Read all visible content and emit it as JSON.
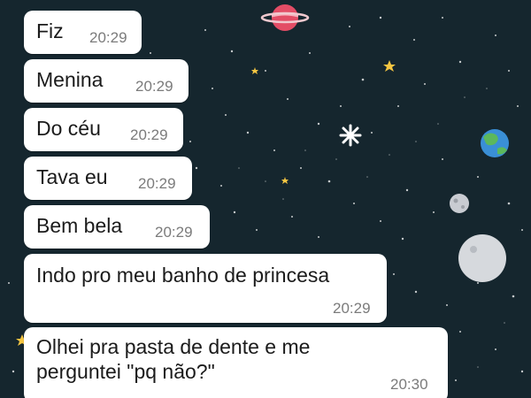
{
  "chat": {
    "messages": [
      {
        "text": "Fiz",
        "time": "20:29"
      },
      {
        "text": "Menina",
        "time": "20:29"
      },
      {
        "text": "Do céu",
        "time": "20:29"
      },
      {
        "text": "Tava eu",
        "time": "20:29"
      },
      {
        "text": "Bem bela",
        "time": "20:29"
      },
      {
        "text": "Indo pro meu banho de princesa",
        "time": "20:29"
      },
      {
        "text": "Olhei pra pasta de dente e me perguntei \"pq não?\"",
        "time": "20:30"
      }
    ]
  },
  "wallpaper": {
    "background_color": "#15262e",
    "decorations": [
      "ringed-planet-icon",
      "earth-icon",
      "moon-icon",
      "star-icon"
    ]
  }
}
